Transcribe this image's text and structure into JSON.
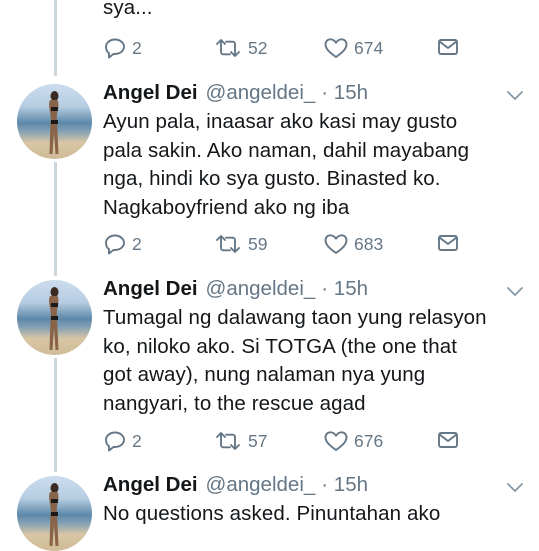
{
  "top_tweet": {
    "text_tail": "sya...",
    "actions": {
      "replies": "2",
      "retweets": "52",
      "likes": "674"
    }
  },
  "tweets": [
    {
      "name": "Angel Dei",
      "handle": "@angeldei_",
      "time": "· 15h",
      "text": "Ayun pala, inaasar ako kasi may gusto\npala sakin. Ako naman, dahil mayabang\nnga, hindi ko sya gusto. Binasted ko.\nNagkaboyfriend ako ng iba",
      "actions": {
        "replies": "2",
        "retweets": "59",
        "likes": "683"
      }
    },
    {
      "name": "Angel Dei",
      "handle": "@angeldei_",
      "time": "· 15h",
      "text": "Tumagal ng dalawang taon yung relasyon\nko, niloko ako. Si TOTGA (the one that\ngot away), nung nalaman nya yung\nnangyari, to the rescue agad",
      "actions": {
        "replies": "2",
        "retweets": "57",
        "likes": "676"
      }
    },
    {
      "name": "Angel Dei",
      "handle": "@angeldei_",
      "time": "· 15h",
      "text": "No questions asked. Pinuntahan ako"
    }
  ],
  "icons": {
    "reply": "reply-icon",
    "retweet": "retweet-icon",
    "like": "heart-icon",
    "message": "envelope-icon",
    "caret": "chevron-down-icon"
  },
  "colors": {
    "text": "#14171a",
    "secondary": "#657786",
    "thread_line": "#ccd6dd"
  }
}
